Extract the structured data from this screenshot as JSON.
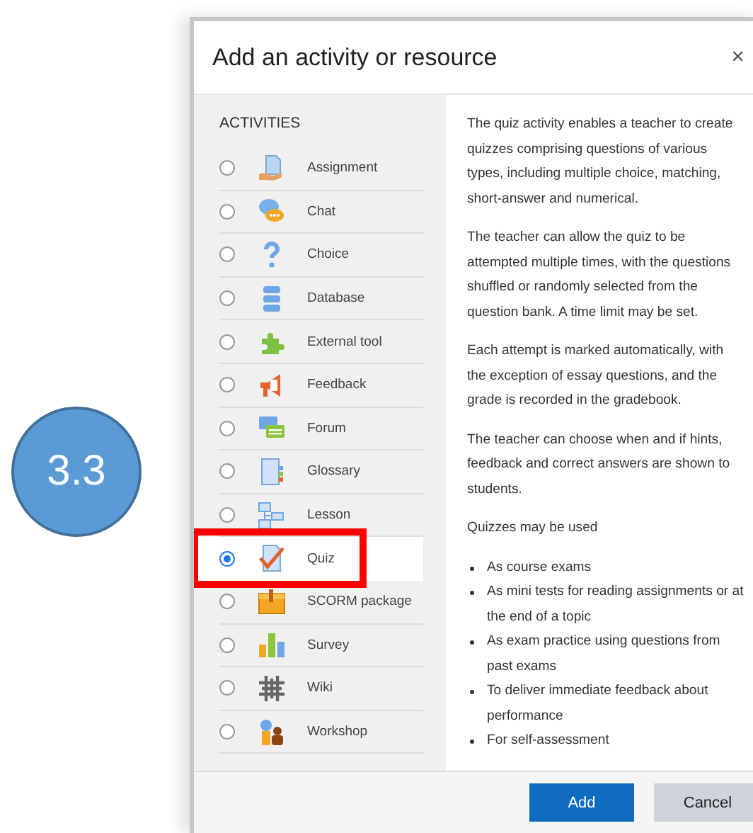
{
  "badge": {
    "text": "3.3"
  },
  "dialog": {
    "title": "Add an activity or resource",
    "close": "×",
    "section_heading": "ACTIVITIES",
    "items": [
      {
        "label": "Assignment",
        "selected": false,
        "highlighted": false
      },
      {
        "label": "Chat",
        "selected": false,
        "highlighted": false
      },
      {
        "label": "Choice",
        "selected": false,
        "highlighted": false
      },
      {
        "label": "Database",
        "selected": false,
        "highlighted": false
      },
      {
        "label": "External tool",
        "selected": false,
        "highlighted": false
      },
      {
        "label": "Feedback",
        "selected": false,
        "highlighted": false
      },
      {
        "label": "Forum",
        "selected": false,
        "highlighted": false
      },
      {
        "label": "Glossary",
        "selected": false,
        "highlighted": false
      },
      {
        "label": "Lesson",
        "selected": false,
        "highlighted": false
      },
      {
        "label": "Quiz",
        "selected": true,
        "highlighted": true
      },
      {
        "label": "SCORM package",
        "selected": false,
        "highlighted": false
      },
      {
        "label": "Survey",
        "selected": false,
        "highlighted": false
      },
      {
        "label": "Wiki",
        "selected": false,
        "highlighted": false
      },
      {
        "label": "Workshop",
        "selected": false,
        "highlighted": false
      }
    ],
    "description": [
      {
        "kind": "paragraph",
        "text": "The quiz activity enables a teacher to create quizzes comprising questions of various types, including multiple choice, matching, short-answer and numerical."
      },
      {
        "kind": "paragraph",
        "text": "The teacher can allow the quiz to be attempted multiple times, with the questions shuffled or randomly selected from the question bank. A time limit may be set."
      },
      {
        "kind": "paragraph",
        "text": "Each attempt is marked automatically, with the exception of essay questions, and the grade is recorded in the gradebook."
      },
      {
        "kind": "paragraph",
        "text": "The teacher can choose when and if hints, feedback and correct answers are shown to students."
      },
      {
        "kind": "paragraph",
        "text": "Quizzes may be used"
      },
      {
        "kind": "list",
        "items": [
          "As course exams",
          "As mini tests for reading assignments or at the end of a topic",
          "As exam practice using questions from past exams",
          "To deliver immediate feedback about performance",
          "For self-assessment"
        ]
      }
    ],
    "buttons": [
      {
        "label": "Add",
        "kind": "primary"
      },
      {
        "label": "Cancel",
        "kind": "secondary"
      }
    ]
  }
}
